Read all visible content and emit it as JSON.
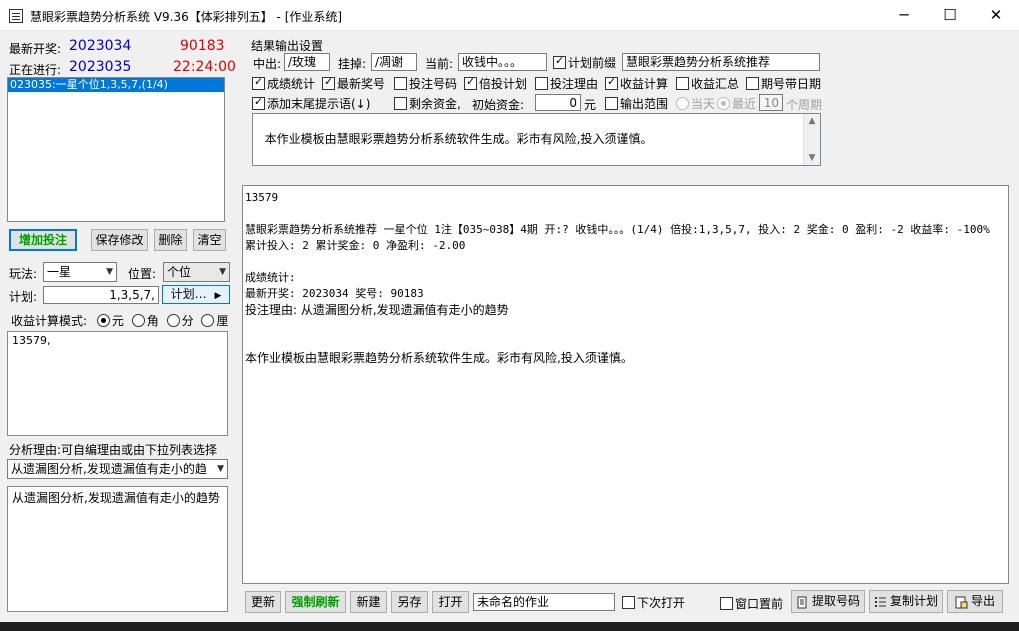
{
  "window": {
    "title": "慧眼彩票趋势分析系统 V9.36【体彩排列五】 - [作业系统]",
    "min_glyph": "─",
    "max_glyph": "☐",
    "close_glyph": "✕"
  },
  "left": {
    "latest_label": "最新开奖:",
    "latest_issue": "2023034",
    "latest_number": "90183",
    "current_label": "正在进行:",
    "current_issue": "2023035",
    "current_time": "22:24:00",
    "plan_list": [
      "023035:一星个位1,3,5,7,(1/4)"
    ],
    "buttons": {
      "add": "增加投注",
      "save": "保存修改",
      "delete": "删除",
      "clear": "清空"
    },
    "play_label": "玩法:",
    "play_value": "一星",
    "position_label": "位置:",
    "position_value": "个位",
    "plan_label": "计划:",
    "plan_value": "1,3,5,7,",
    "plan_button": "计划…",
    "calc_mode_label": "收益计算模式:",
    "calc_modes": [
      "元",
      "角",
      "分",
      "厘"
    ],
    "numbers_memo": "13579,",
    "reason_label": "分析理由:可自编理由或由下拉列表选择",
    "reason_combo": "从遗漏图分析,发现遗漏值有走小的趋",
    "reason_memo": "从遗漏图分析,发现遗漏值有走小的趋势"
  },
  "settings": {
    "group_title": "结果输出设置",
    "hit_label": "中出:",
    "hit_value": "/玫瑰",
    "miss_label": "挂掉:",
    "miss_value": "/凋谢",
    "current_label": "当前:",
    "current_value": "收钱中。。。",
    "plan_prefix_label": "计划前缀",
    "plan_prefix_value": "慧眼彩票趋势分析系统推荐",
    "options_row1": [
      "成绩统计",
      "最新奖号",
      "投注号码",
      "倍投计划",
      "投注理由",
      "收益计算",
      "收益汇总",
      "期号带日期"
    ],
    "options_row2_tail": "添加末尾提示语(↓)",
    "remaining_label": "剩余资金,",
    "initial_label": "初始资金:",
    "initial_value": "0",
    "yuan": "元",
    "output_range": "输出范围",
    "today": "当天",
    "recent": "最近",
    "recent_value": "10",
    "cycles": "个周期",
    "footer_memo": "本作业模板由慧眼彩票趋势分析系统软件生成。彩市有风险,投入须谨慎。"
  },
  "output": {
    "lines": [
      "13579",
      "",
      "慧眼彩票趋势分析系统推荐 一星个位 1注【035~038】4期 开:? 收钱中。。。(1/4) 倍投:1,3,5,7, 投入: 2 奖金: 0 盈利: -2 收益率: -100% 累计投入: 2 累计奖金: 0 净盈利: -2.00",
      "",
      "成绩统计:",
      "最新开奖: 2023034 奖号: 90183",
      "投注理由: 从遗漏图分析,发现遗漏值有走小的趋势",
      "",
      "",
      "本作业模板由慧眼彩票趋势分析系统软件生成。彩市有风险,投入须谨慎。"
    ]
  },
  "bottom": {
    "update": "更新",
    "force_refresh": "强制刷新",
    "new": "新建",
    "save_as": "另存",
    "open": "打开",
    "filename": "未命名的作业",
    "open_next": "下次打开",
    "window_top": "窗口置前",
    "fetch_numbers": "提取号码",
    "copy_plan": "复制计划",
    "export": "导出"
  }
}
